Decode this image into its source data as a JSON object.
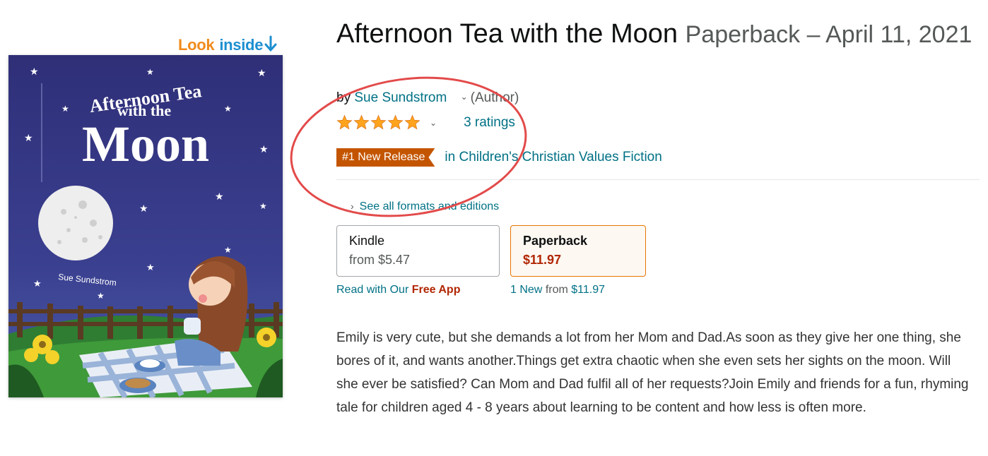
{
  "look_inside": {
    "look": "Look",
    "inside": "inside"
  },
  "cover": {
    "title_line1": "Afternoon Tea",
    "title_line2": "with the",
    "title_line3": "Moon",
    "author": "Sue Sundstrom"
  },
  "product": {
    "title": "Afternoon Tea with the Moon",
    "subtitle": "Paperback – April 11, 2021",
    "by": "by",
    "author": "Sue Sundstrom",
    "author_role": "(Author)",
    "rating_stars": 5,
    "ratings_count": "3 ratings",
    "badge": "#1 New Release",
    "badge_category": "in Children's Christian Values Fiction",
    "see_all": "See all formats and editions"
  },
  "formats": {
    "kindle": {
      "name": "Kindle",
      "price": "from $5.47"
    },
    "paperback": {
      "name": "Paperback",
      "price": "$11.97"
    },
    "kindle_note_prefix": "Read with Our",
    "kindle_note_free": "Free App",
    "paper_note_new": "1 New",
    "paper_note_from": "from",
    "paper_note_price": "$11.97"
  },
  "description": "Emily is very cute, but she demands a lot from her Mom and Dad.As soon as they give her one thing, she bores of it, and wants another.Things get extra chaotic when she even sets her sights on the moon. Will she ever be satisfied? Can Mom and Dad fulfil all of her requests?Join Emily and friends for a fun, rhyming tale for children aged 4 - 8 years about learning to be content and how less is often more.",
  "colors": {
    "link": "#007185",
    "price": "#b12704",
    "badge": "#c45500",
    "star": "#ffa41c",
    "annotation": "#e34a4a",
    "cover_bg": "#343a7e"
  }
}
